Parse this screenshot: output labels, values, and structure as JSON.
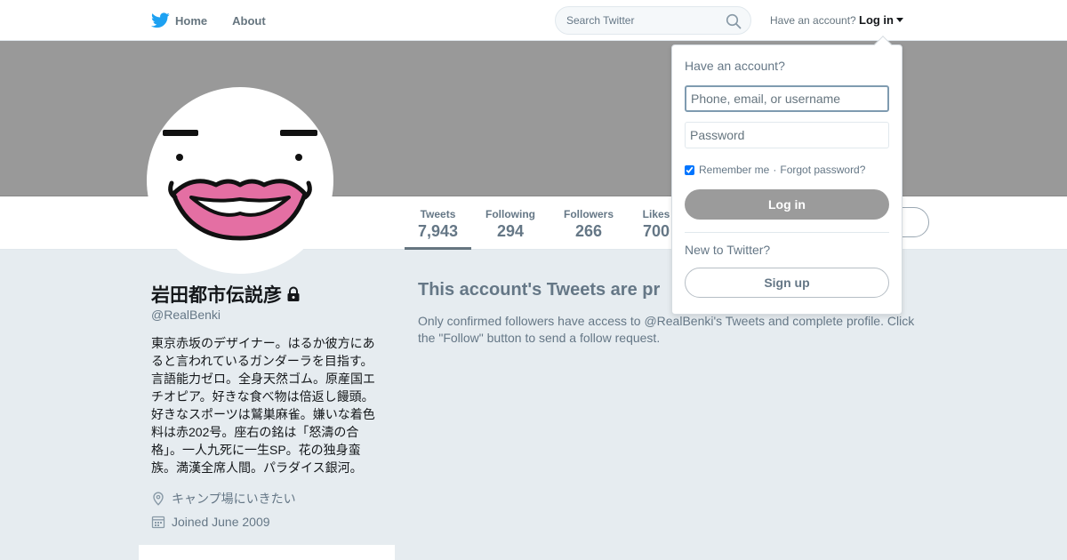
{
  "nav": {
    "home_label": "Home",
    "about_label": "About",
    "search_placeholder": "Search Twitter",
    "have_account": "Have an account?",
    "login_label": "Log in"
  },
  "profile": {
    "name": "岩田都市伝説彦",
    "handle": "@RealBenki",
    "bio": "東京赤坂のデザイナー。はるか彼方にあると言われているガンダーラを目指す。言語能力ゼロ。全身天然ゴム。原産国エチオピア。好きな食べ物は倍返し饅頭。好きなスポーツは鷲巣麻雀。嫌いな着色料は赤202号。座右の銘は「怒濤の合格」。一人九死に一生SP。花の独身蛮族。満漢全席人間。パラダイス銀河。",
    "location": "キャンプ場にいきたい",
    "joined": "Joined June 2009"
  },
  "stats": {
    "tweets_label": "Tweets",
    "tweets_value": "7,943",
    "following_label": "Following",
    "following_value": "294",
    "followers_label": "Followers",
    "followers_value": "266",
    "likes_label": "Likes",
    "likes_value": "700"
  },
  "protected": {
    "title": "This account's Tweets are pr",
    "message": "Only confirmed followers have access to @RealBenki's Tweets and complete profile. Click the \"Follow\" button to send a follow request."
  },
  "login_dropdown": {
    "heading": "Have an account?",
    "username_placeholder": "Phone, email, or username",
    "password_placeholder": "Password",
    "remember_label": "Remember me",
    "separator": "·",
    "forgot_label": "Forgot password?",
    "login_button": "Log in",
    "new_label": "New to Twitter?",
    "signup_button": "Sign up"
  },
  "colors": {
    "banner": "#999999",
    "brand_blue": "#1da1f2",
    "lips_pink": "#e46fa3",
    "login_button": "#9b9b9b"
  },
  "icons": {
    "logo": "twitter-bird-icon",
    "search": "search-icon",
    "lock": "lock-icon",
    "location": "location-pin-icon",
    "calendar": "calendar-icon"
  }
}
